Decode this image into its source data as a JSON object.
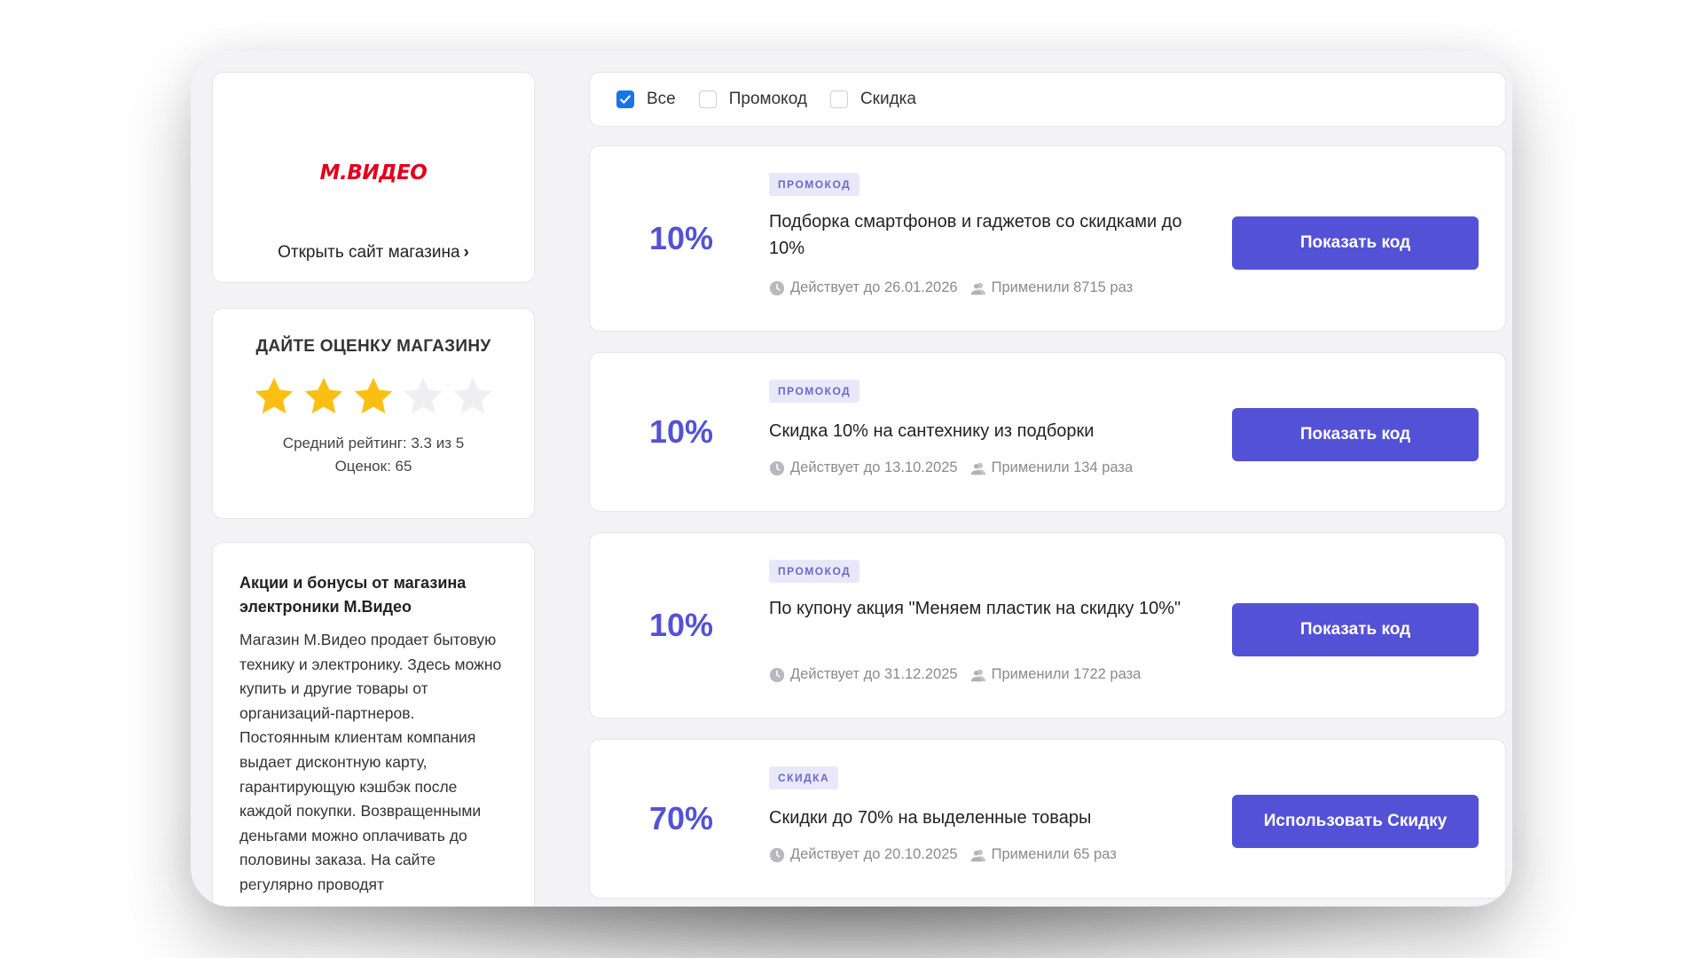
{
  "store": {
    "logo_text": "М.ВИДЕО",
    "open_site_label": "Открыть сайт магазина",
    "brand_color": "#e3001b"
  },
  "rating": {
    "title": "ДАЙТЕ ОЦЕНКУ МАГАЗИНУ",
    "filled_stars": 3,
    "max_stars": 5,
    "average_text": "Средний рейтинг: 3.3 из 5",
    "count_text": "Оценок: 65"
  },
  "about": {
    "title": "Акции и бонусы от магазина электроники М.Видео",
    "text": "Магазин М.Видео продает бытовую технику и электронику. Здесь можно купить и другие товары от организаций-партнеров. Постоянным клиентам компания выдает дисконтную карту, гарантирующую кэшбэк после каждой покупки. Возвращенными деньгами можно оплачивать до половины заказа. На сайте регулярно проводят"
  },
  "filters": [
    {
      "label": "Все",
      "checked": true
    },
    {
      "label": "Промокод",
      "checked": false
    },
    {
      "label": "Скидка",
      "checked": false
    }
  ],
  "coupons": [
    {
      "percent": "10%",
      "badge": "ПРОМОКОД",
      "title": "Подборка смартфонов и гаджетов со скидками до 10%",
      "valid": "Действует до 26.01.2026",
      "used": "Применили 8715 раз",
      "button": "Показать код"
    },
    {
      "percent": "10%",
      "badge": "ПРОМОКОД",
      "title": "Скидка 10% на сантехнику из подборки",
      "valid": "Действует до 13.10.2025",
      "used": "Применили 134 раза",
      "button": "Показать код"
    },
    {
      "percent": "10%",
      "badge": "ПРОМОКОД",
      "title": "По купону акция \"Меняем пластик на скидку 10%\"",
      "valid": "Действует до 31.12.2025",
      "used": "Применили 1722 раза",
      "button": "Показать код"
    },
    {
      "percent": "70%",
      "badge": "СКИДКА",
      "title": "Скидки до 70% на выделенные товары",
      "valid": "Действует до 20.10.2025",
      "used": "Применили 65 раз",
      "button": "Использовать Скидку"
    }
  ],
  "colors": {
    "accent": "#5352d6",
    "badge_bg": "#e9e8fb",
    "star_filled": "#fbbf14",
    "star_empty": "#efeff2",
    "checkbox_checked": "#1a73e8"
  }
}
